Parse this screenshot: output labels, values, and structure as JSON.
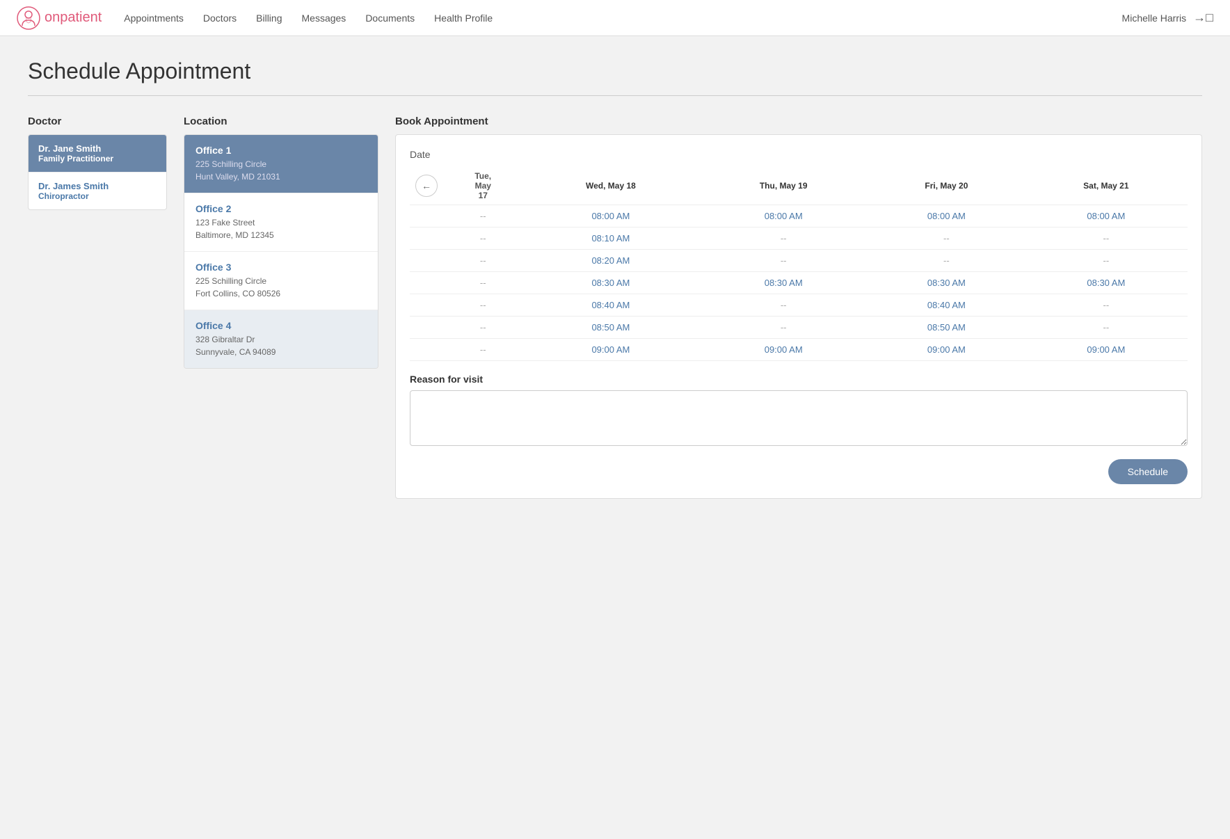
{
  "app": {
    "name": "onpatient",
    "logo_alt": "onpatient logo"
  },
  "nav": {
    "links": [
      "Appointments",
      "Doctors",
      "Billing",
      "Messages",
      "Documents",
      "Health Profile"
    ],
    "user": "Michelle Harris",
    "logout_label": "logout"
  },
  "page": {
    "title": "Schedule Appointment"
  },
  "doctor_section": {
    "label": "Doctor",
    "doctors": [
      {
        "name": "Dr. Jane Smith",
        "specialty": "Family Practitioner",
        "selected": true
      },
      {
        "name": "Dr. James Smith",
        "specialty": "Chiropractor",
        "selected": false
      }
    ]
  },
  "location_section": {
    "label": "Location",
    "locations": [
      {
        "name": "Office 1",
        "address_line1": "225 Schilling Circle",
        "address_line2": "Hunt Valley, MD 21031",
        "state": "selected"
      },
      {
        "name": "Office 2",
        "address_line1": "123 Fake Street",
        "address_line2": "Baltimore, MD 12345",
        "state": "normal"
      },
      {
        "name": "Office 3",
        "address_line1": "225 Schilling Circle",
        "address_line2": "Fort Collins, CO 80526",
        "state": "normal"
      },
      {
        "name": "Office 4",
        "address_line1": "328 Gibraltar Dr",
        "address_line2": "Sunnyvale, CA 94089",
        "state": "highlighted"
      }
    ]
  },
  "book_section": {
    "label": "Book Appointment",
    "date_label": "Date",
    "nav_prev": "←",
    "columns": [
      {
        "id": "tue",
        "header_line1": "Tue,",
        "header_line2": "May",
        "header_line3": "17"
      },
      {
        "id": "wed",
        "header": "Wed, May 18"
      },
      {
        "id": "thu",
        "header": "Thu, May 19"
      },
      {
        "id": "fri",
        "header": "Fri, May 20"
      },
      {
        "id": "sat",
        "header": "Sat, May 21"
      }
    ],
    "rows": [
      {
        "tue": "--",
        "wed": "08:00 AM",
        "thu": "08:00 AM",
        "fri": "08:00 AM",
        "sat": "08:00 AM"
      },
      {
        "tue": "--",
        "wed": "08:10 AM",
        "thu": "--",
        "fri": "--",
        "sat": "--"
      },
      {
        "tue": "--",
        "wed": "08:20 AM",
        "thu": "--",
        "fri": "--",
        "sat": "--"
      },
      {
        "tue": "--",
        "wed": "08:30 AM",
        "thu": "08:30 AM",
        "fri": "08:30 AM",
        "sat": "08:30 AM"
      },
      {
        "tue": "--",
        "wed": "08:40 AM",
        "thu": "--",
        "fri": "08:40 AM",
        "sat": "--"
      },
      {
        "tue": "--",
        "wed": "08:50 AM",
        "thu": "--",
        "fri": "08:50 AM",
        "sat": "--"
      },
      {
        "tue": "--",
        "wed": "09:00 AM",
        "thu": "09:00 AM",
        "fri": "09:00 AM",
        "sat": "09:00 AM"
      }
    ],
    "reason_label": "Reason for visit",
    "reason_placeholder": "",
    "schedule_btn": "Schedule"
  }
}
